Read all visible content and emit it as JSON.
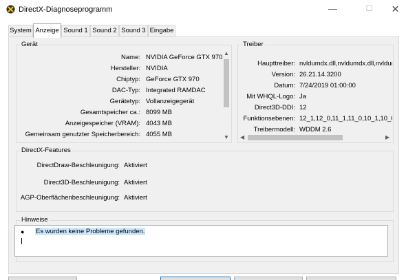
{
  "window": {
    "title": "DirectX-Diagnoseprogramm",
    "minimize_icon": "minimize-icon",
    "maximize_icon": "maximize-icon",
    "close_icon": "close-icon"
  },
  "tabs": [
    {
      "label": "System"
    },
    {
      "label": "Anzeige",
      "active": true
    },
    {
      "label": "Sound 1"
    },
    {
      "label": "Sound 2"
    },
    {
      "label": "Sound 3"
    },
    {
      "label": "Eingabe"
    }
  ],
  "device": {
    "group_label": "Gerät",
    "rows": [
      {
        "label": "Name:",
        "value": "NVIDIA GeForce GTX 970"
      },
      {
        "label": "Hersteller:",
        "value": "NVIDIA"
      },
      {
        "label": "Chiptyp:",
        "value": "GeForce GTX 970"
      },
      {
        "label": "DAC-Typ:",
        "value": "Integrated RAMDAC"
      },
      {
        "label": "Gerätetyp:",
        "value": "Vollanzeigegerät"
      },
      {
        "label": "Gesamtspeicher ca.:",
        "value": "8099 MB"
      },
      {
        "label": "Anzeigespeicher (VRAM):",
        "value": "4043 MB"
      },
      {
        "label": "Gemeinsam genutzter Speicherbereich:",
        "value": "4055 MB"
      }
    ]
  },
  "driver": {
    "group_label": "Treiber",
    "rows": [
      {
        "label": "Haupttreiber:",
        "value": "nvldumdx.dll,nvldumdx.dll,nvldumd"
      },
      {
        "label": "Version:",
        "value": "26.21.14.3200"
      },
      {
        "label": "Datum:",
        "value": "7/24/2019 01:00:00"
      },
      {
        "label": "Mit WHQL-Logo:",
        "value": "Ja"
      },
      {
        "label": "Direct3D-DDI:",
        "value": "12"
      },
      {
        "label": "Funktionsebenen:",
        "value": "12_1,12_0,11_1,11_0,10_1,10_0,"
      },
      {
        "label": "Treibermodell:",
        "value": "WDDM 2.6"
      }
    ]
  },
  "features": {
    "group_label": "DirectX-Features",
    "rows": [
      {
        "label": "DirectDraw-Beschleunigung:",
        "value": "Aktiviert"
      },
      {
        "label": "Direct3D-Beschleunigung:",
        "value": "Aktiviert"
      },
      {
        "label": "AGP-Oberflächenbeschleunigung:",
        "value": "Aktiviert"
      }
    ]
  },
  "notes": {
    "group_label": "Hinweise",
    "items": [
      "Es wurden keine Probleme gefunden."
    ]
  }
}
